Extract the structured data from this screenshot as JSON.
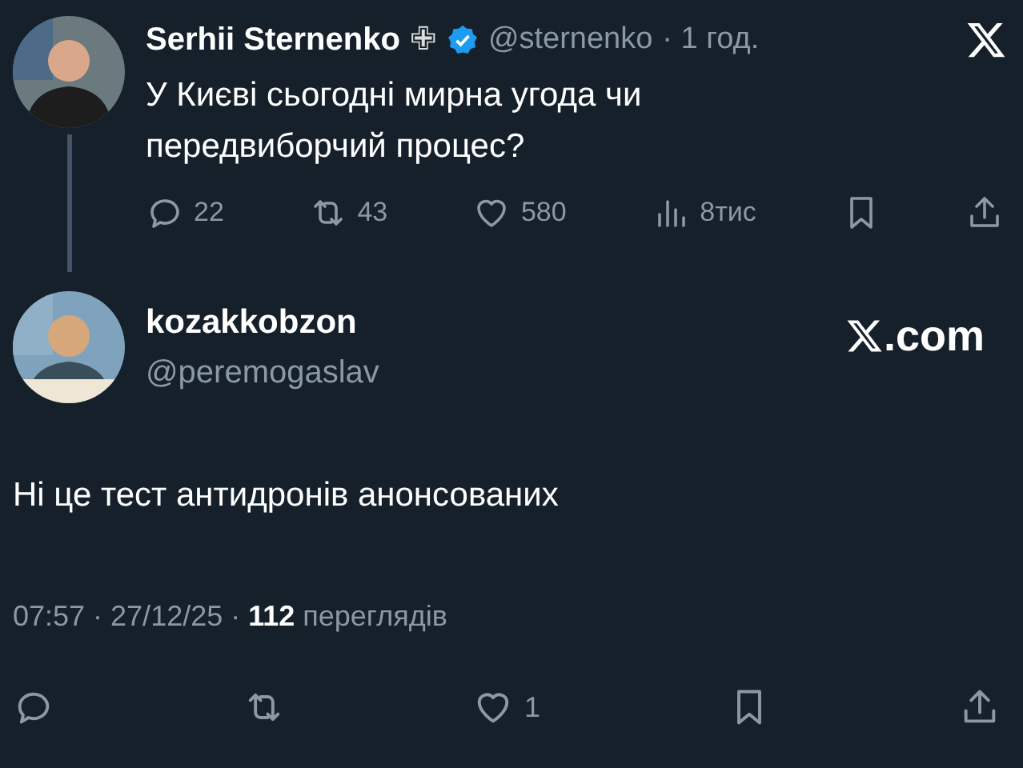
{
  "parent_post": {
    "author_name": "Serhii Sternenko",
    "author_badge": "✙",
    "handle": "@sternenko",
    "time": "· 1 год.",
    "text": "У Києві сьогодні мирна угода чи передвиборчий процес?",
    "actions": [
      {
        "kind": "reply",
        "count": "22"
      },
      {
        "kind": "repost",
        "count": "43"
      },
      {
        "kind": "like",
        "count": "580"
      },
      {
        "kind": "views",
        "count": "8тис"
      },
      {
        "kind": "bookmark"
      },
      {
        "kind": "share"
      }
    ]
  },
  "reply_post": {
    "author_name": "kozakkobzon",
    "handle": "@peremogaslav",
    "site": ".com",
    "text": "Ні це тест антидронів анонсованих",
    "time": "07:57 · 27/12/25 ·",
    "views_count": "112",
    "views_label": "переглядів",
    "actions": [
      {
        "kind": "reply"
      },
      {
        "kind": "repost"
      },
      {
        "kind": "like",
        "count": "1"
      },
      {
        "kind": "bookmark"
      },
      {
        "kind": "share"
      }
    ]
  }
}
